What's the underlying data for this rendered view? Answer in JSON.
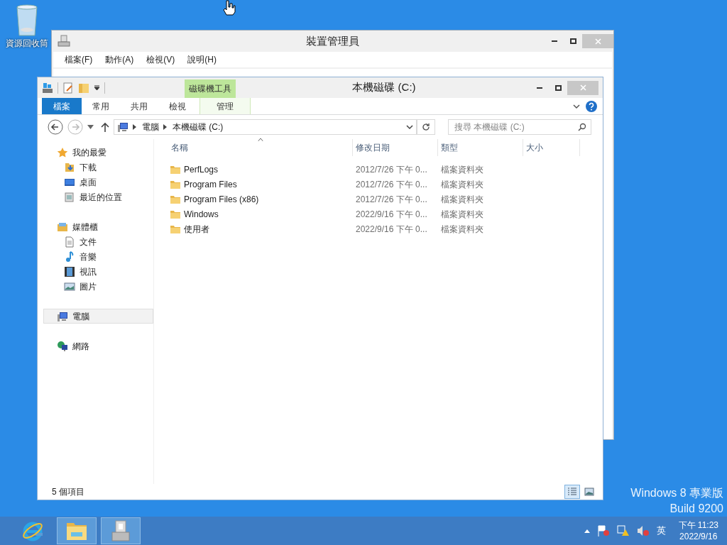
{
  "desktop_icons": [
    {
      "label": "資源回收筒"
    }
  ],
  "background_window": {
    "title": "裝置管理員",
    "menu": [
      "檔案(F)",
      "動作(A)",
      "檢視(V)",
      "說明(H)"
    ]
  },
  "explorer": {
    "title": "本機磁碟 (C:)",
    "context_group": "磁碟機工具",
    "ribbon_tabs": [
      {
        "label": "檔案",
        "kind": "file"
      },
      {
        "label": "常用",
        "kind": "normal"
      },
      {
        "label": "共用",
        "kind": "normal"
      },
      {
        "label": "檢視",
        "kind": "normal"
      },
      {
        "label": "管理",
        "kind": "context"
      }
    ],
    "address": {
      "crumbs": [
        "電腦",
        "本機磁碟 (C:)"
      ]
    },
    "search": {
      "placeholder": "搜尋 本機磁碟 (C:)"
    },
    "nav": [
      {
        "label": "我的最愛",
        "kind": "star",
        "selected": false,
        "children": [
          {
            "label": "下載",
            "kind": "download",
            "selected": false
          },
          {
            "label": "桌面",
            "kind": "desktop",
            "selected": false
          },
          {
            "label": "最近的位置",
            "kind": "recent",
            "selected": false
          }
        ]
      },
      {
        "label": "媒體櫃",
        "kind": "library",
        "selected": false,
        "children": [
          {
            "label": "文件",
            "kind": "document",
            "selected": false
          },
          {
            "label": "音樂",
            "kind": "music",
            "selected": false
          },
          {
            "label": "視訊",
            "kind": "video",
            "selected": false
          },
          {
            "label": "圖片",
            "kind": "picture",
            "selected": false
          }
        ]
      },
      {
        "label": "電腦",
        "kind": "computer",
        "selected": true
      },
      {
        "label": "網路",
        "kind": "network",
        "selected": false
      }
    ],
    "columns": [
      {
        "label": "名稱",
        "sorted": true
      },
      {
        "label": "修改日期",
        "sorted": false
      },
      {
        "label": "類型",
        "sorted": false
      },
      {
        "label": "大小",
        "sorted": false
      }
    ],
    "rows": [
      {
        "name": "PerfLogs",
        "modified": "2012/7/26 下午 0...",
        "type": "檔案資料夾"
      },
      {
        "name": "Program Files",
        "modified": "2012/7/26 下午 0...",
        "type": "檔案資料夾"
      },
      {
        "name": "Program Files (x86)",
        "modified": "2012/7/26 下午 0...",
        "type": "檔案資料夾"
      },
      {
        "name": "Windows",
        "modified": "2022/9/16 下午 0...",
        "type": "檔案資料夾"
      },
      {
        "name": "使用者",
        "modified": "2022/9/16 下午 0...",
        "type": "檔案資料夾"
      }
    ],
    "status": "5 個項目",
    "views": [
      {
        "kind": "details",
        "selected": true
      },
      {
        "kind": "large",
        "selected": false
      }
    ]
  },
  "edition": [
    "Windows 8 專業版",
    "Build 9200"
  ],
  "taskbar": {
    "apps": [
      {
        "kind": "browser",
        "running": false
      },
      {
        "kind": "explorer",
        "running": true
      },
      {
        "kind": "devmgr",
        "running": true
      }
    ],
    "ime": "英",
    "time": "下午 11:23",
    "date": "2022/9/16"
  }
}
